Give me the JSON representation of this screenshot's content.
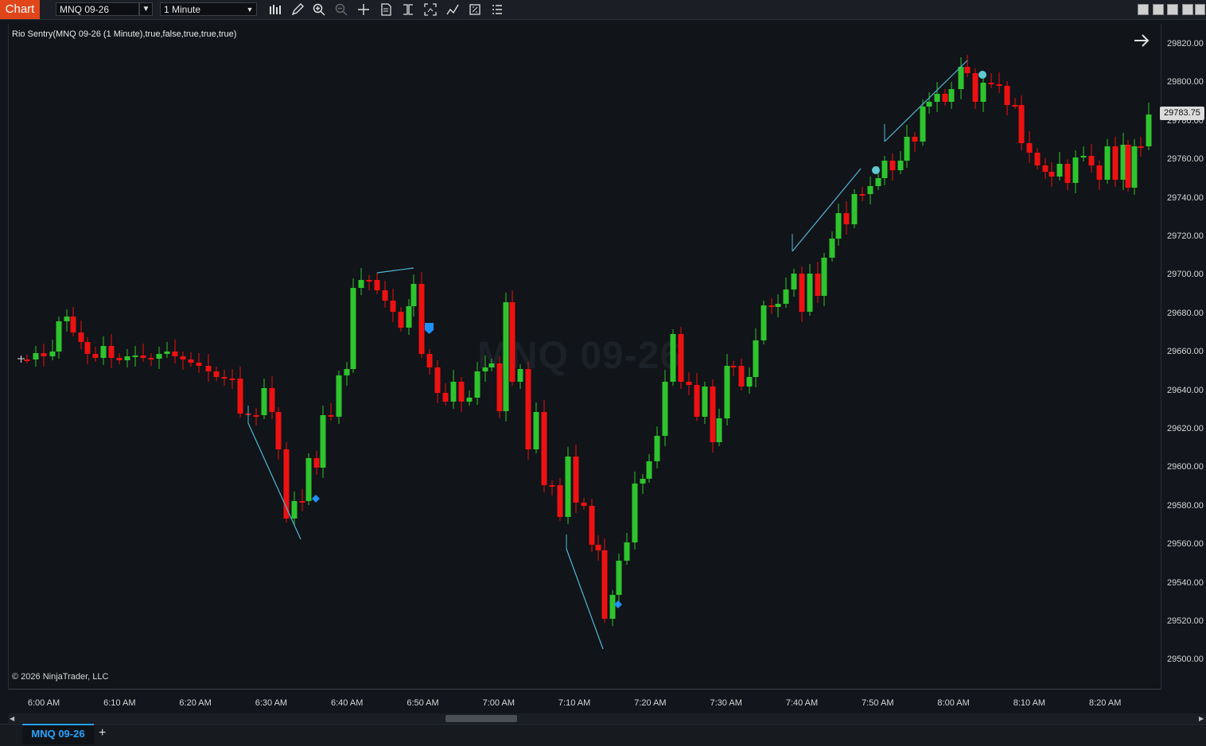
{
  "toolbar": {
    "tab_label": "Chart",
    "instrument": "MNQ 09-26",
    "interval": "1 Minute",
    "icons": [
      "bar-type-icon",
      "draw-pencil-icon",
      "zoom-in-icon",
      "zoom-out-icon",
      "crosshair-icon",
      "template-icon",
      "data-box-icon",
      "strategies-icon",
      "indicators-icon",
      "properties-icon",
      "menu-icon"
    ]
  },
  "chart": {
    "indicator_label": "Rio Sentry(MNQ 09-26 (1 Minute),true,false,true,true,true)",
    "watermark": "MNQ 09-26",
    "copyright": "© 2026 NinjaTrader, LLC",
    "last_price": "29783.75",
    "price_labels": [
      "29820.00",
      "29800.00",
      "29780.00",
      "29760.00",
      "29740.00",
      "29720.00",
      "29700.00",
      "29680.00",
      "29660.00",
      "29640.00",
      "29620.00",
      "29600.00",
      "29580.00",
      "29560.00",
      "29540.00",
      "29520.00",
      "29500.00"
    ],
    "time_labels": [
      "6:00 AM",
      "6:10 AM",
      "6:20 AM",
      "6:30 AM",
      "6:40 AM",
      "6:50 AM",
      "7:00 AM",
      "7:10 AM",
      "7:20 AM",
      "7:30 AM",
      "7:40 AM",
      "7:50 AM",
      "8:00 AM",
      "8:10 AM",
      "8:20 AM"
    ],
    "colors": {
      "up": "#2ec42e",
      "down": "#ee1111",
      "line": "#4fb7d6",
      "marker": "#1e90ff",
      "dot": "#5fc9d6"
    }
  },
  "bottom": {
    "tab_label": "MNQ 09-26",
    "add_label": "+"
  }
}
